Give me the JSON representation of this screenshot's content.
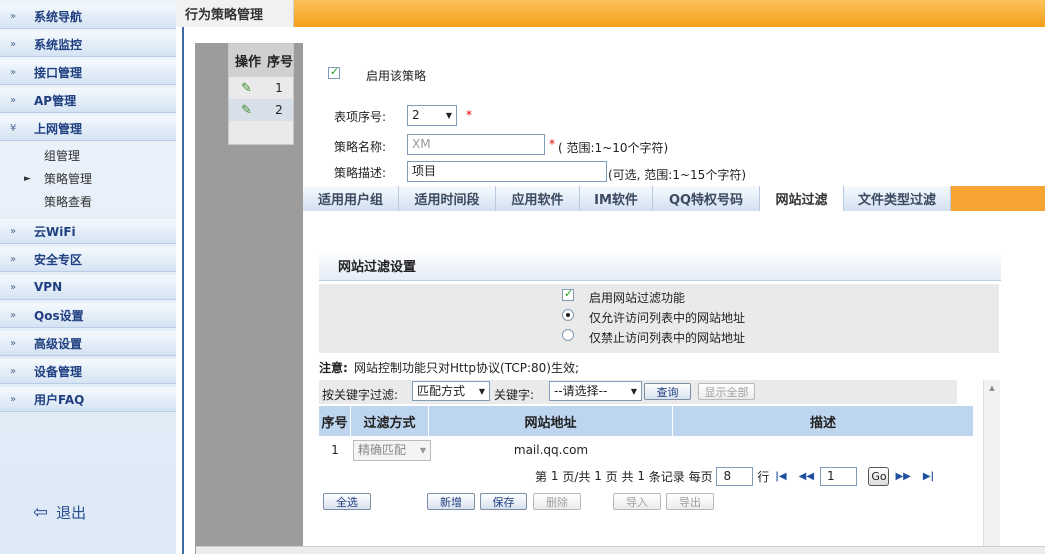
{
  "sidebar": {
    "items": [
      {
        "label": "系统导航"
      },
      {
        "label": "系统监控"
      },
      {
        "label": "接口管理"
      },
      {
        "label": "AP管理"
      },
      {
        "label": "上网管理",
        "expanded": true,
        "subitems": [
          {
            "label": "组管理"
          },
          {
            "label": "策略管理",
            "active": true
          },
          {
            "label": "策略查看"
          }
        ]
      },
      {
        "label": "云WiFi"
      },
      {
        "label": "安全专区"
      },
      {
        "label": "VPN"
      },
      {
        "label": "Qos设置"
      },
      {
        "label": "高级设置"
      },
      {
        "label": "设备管理"
      },
      {
        "label": "用户FAQ"
      }
    ],
    "logout_label": "退出"
  },
  "header": {
    "title": "行为策略管理"
  },
  "policy_list": {
    "columns": [
      "操作",
      "序号"
    ],
    "rows": [
      {
        "num": "1"
      },
      {
        "num": "2"
      }
    ]
  },
  "form": {
    "enable_label": "启用该策略",
    "enable_checked": true,
    "index_label": "表项序号:",
    "index_value": "2",
    "required_mark": "*",
    "name_label": "策略名称:",
    "name_placeholder": "XM",
    "name_hint": "( 范围:1~10个字符)",
    "desc_label": "策略描述:",
    "desc_value": "项目",
    "desc_hint": "(可选, 范围:1~15个字符)"
  },
  "tabs": [
    "适用用户组",
    "适用时间段",
    "应用软件",
    "IM软件",
    "QQ特权号码",
    "网站过滤",
    "文件类型过滤"
  ],
  "active_tab": "网站过滤",
  "website_filter": {
    "section_title": "网站过滤设置",
    "enable_label": "启用网站过滤功能",
    "enable_checked": true,
    "allow_label": "仅允许访问列表中的网站地址",
    "deny_label": "仅禁止访问列表中的网站地址",
    "mode": "allow",
    "note_label": "注意:",
    "note_text": "网站控制功能只对Http协议(TCP:80)生效;",
    "filter_label": "按关键字过滤:",
    "match_mode": "匹配方式",
    "keyword_label": "关键字:",
    "keyword_value": "--请选择--",
    "query_label": "查询",
    "show_all_label": "显示全部",
    "columns": [
      "序号",
      "过滤方式",
      "网站地址",
      "描述"
    ],
    "rows": [
      {
        "num": "1",
        "method": "精确匹配",
        "url": "mail.qq.com",
        "desc": ""
      }
    ]
  },
  "pager": {
    "page_prefix": "第",
    "page_num": "1",
    "page_sep": "页/共",
    "total_pages": "1",
    "pages_unit": "页 共",
    "total_records": "1",
    "records_unit": "条记录 每页",
    "per_page": "8",
    "per_page_unit": "行",
    "jump_value": "1",
    "go_label": "Go"
  },
  "actions": {
    "select_all": "全选",
    "add": "新增",
    "save": "保存",
    "delete": "删除",
    "import": "导入",
    "export": "导出"
  }
}
